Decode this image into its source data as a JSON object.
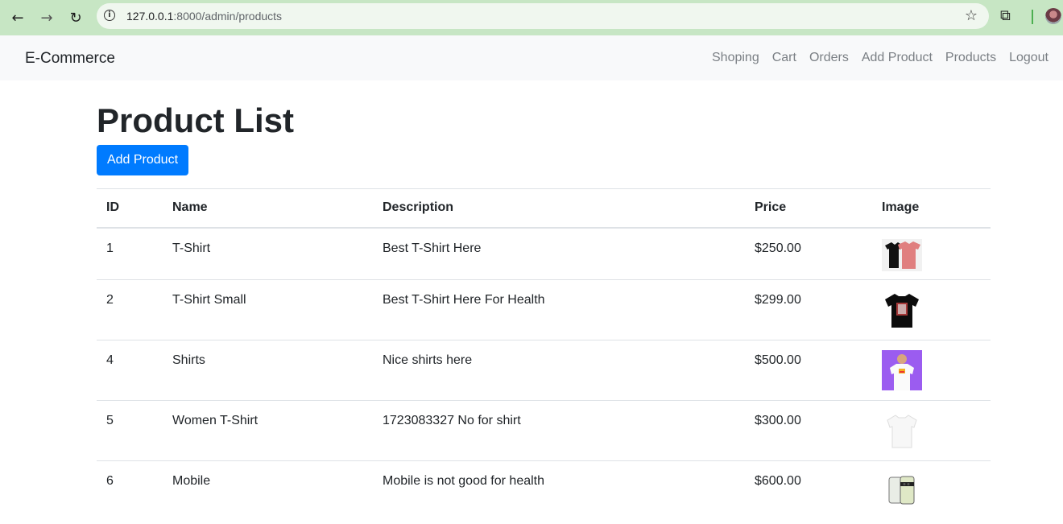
{
  "browser": {
    "url_host": "127.0.0.1",
    "url_rest": ":8000/admin/products",
    "back_icon": "←",
    "forward_icon": "→",
    "reload_icon": "↻",
    "info_icon": "i",
    "star_icon": "☆",
    "extension_icon": "⧉"
  },
  "navbar": {
    "brand": "E-Commerce",
    "links": [
      "Shoping",
      "Cart",
      "Orders",
      "Add Product",
      "Products",
      "Logout"
    ]
  },
  "page": {
    "title": "Product List",
    "add_button": "Add Product"
  },
  "table": {
    "headers": [
      "ID",
      "Name",
      "Description",
      "Price",
      "Image"
    ],
    "rows": [
      {
        "id": "1",
        "name": "T-Shirt",
        "description": "Best T-Shirt Here",
        "price": "$250.00",
        "image": "tshirt-pair"
      },
      {
        "id": "2",
        "name": "T-Shirt Small",
        "description": "Best T-Shirt Here For Health",
        "price": "$299.00",
        "image": "black-tshirt"
      },
      {
        "id": "4",
        "name": "Shirts",
        "description": "Nice shirts here",
        "price": "$500.00",
        "image": "model-shirt"
      },
      {
        "id": "5",
        "name": "Women T-Shirt",
        "description": "1723083327 No for shirt",
        "price": "$300.00",
        "image": "white-tshirt"
      },
      {
        "id": "6",
        "name": "Mobile",
        "description": "Mobile is not good for health",
        "price": "$600.00",
        "image": "mobile-phone"
      }
    ]
  },
  "colors": {
    "primary": "#007bff",
    "chrome": "#c7e6c4",
    "navbar_bg": "#f8f9fa"
  }
}
